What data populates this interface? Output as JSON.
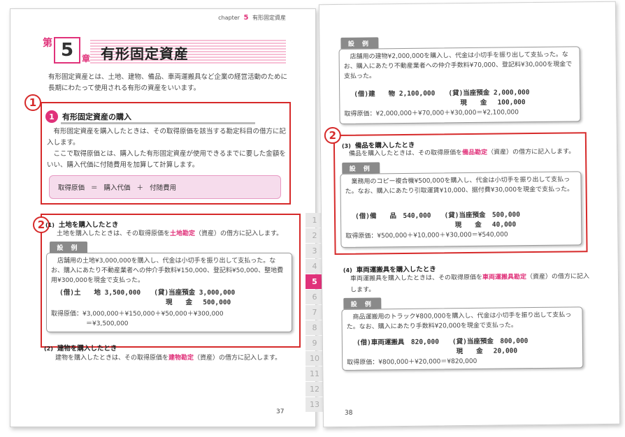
{
  "left": {
    "chapter_header_prefix": "chapter",
    "chapter_header_num": "5",
    "chapter_header_title": "有形固定資産",
    "title_dai": "第",
    "title_num": "5",
    "title_sho": "章",
    "title": "有形固定資産",
    "intro": "有形固定資産とは、土地、建物、備品、車両運搬具など企業の経営活動のために長期にわたって使用される有形の資産をいいます。",
    "badge_1": "1",
    "section1_num": "1",
    "section1_title": "有形固定資産の購入",
    "section1_p1": "有形固定資産を購入したときは、その取得原価を該当する勘定科目の借方に記入します。",
    "section1_p2": "ここで取得原価とは、購入した有形固定資産が使用できるまでに要した金額をいい、購入代価に付随費用を加算して計算します。",
    "formula": "取得原価 ＝ 購入代価 ＋ 付随費用",
    "badge_2": "2",
    "sub1_num": "(1)",
    "sub1_title": "土地を購入したとき",
    "sub1_pre": "土地を購入したときは、その取得原価を",
    "sub1_account": "土地勘定",
    "sub1_post": "（資産）の借方に記入します。",
    "example_label": "設 例",
    "ex1_text": "店舗用の土地¥3,000,000を購入し、代金は小切手を振り出して支払った。なお、購入にあたり不動産業者への仲介手数料¥150,000、登記料¥50,000、整地費用¥300,000を現金で支払った。",
    "ex1_entry1": "(借)土　　地 3,500,000　　(貸)当座預金 3,000,000",
    "ex1_entry2": "　　　　　　　　　　　　　　　　現　　金　 500,000",
    "ex1_calc1": "取得原価：¥3,000,000＋¥150,000＋¥50,000＋¥300,000",
    "ex1_calc2": "＝¥3,500,000",
    "sub2_num": "(2)",
    "sub2_title": "建物を購入したとき",
    "sub2_pre": "建物を購入したときは、その取得原価を",
    "sub2_account": "建物勘定",
    "sub2_post": "（資産）の借方に記入します。",
    "page_number": "37",
    "tabs": [
      "1",
      "2",
      "3",
      "4",
      "5",
      "6",
      "7",
      "8",
      "9",
      "10",
      "11",
      "12",
      "13"
    ]
  },
  "right": {
    "example_label": "設 例",
    "ex2_text": "店舗用の建物¥2,000,000を購入し、代金は小切手を振り出して支払った。なお、購入にあたり不動産業者への仲介手数料¥70,000、登記料¥30,000を現金で支払った。",
    "ex2_entry1": "(借)建　　物 2,100,000　　(貸)当座預金 2,000,000",
    "ex2_entry2": "　　　　　　　　　　　　　　　　現　　金　 100,000",
    "ex2_calc": "取得原価：¥2,000,000＋¥70,000＋¥30,000＝¥2,100,000",
    "badge_2": "2",
    "sub3_num": "(3)",
    "sub3_title": "備品を購入したとき",
    "sub3_pre": "備品を購入したときは、その取得原価を",
    "sub3_account": "備品勘定",
    "sub3_post": "（資産）の借方に記入します。",
    "ex3_text": "業務用のコピー複合機¥500,000を購入し、代金は小切手を振り出して支払った。なお、購入にあたり引取運賃¥10,000、据付費¥30,000を現金で支払った。",
    "ex3_entry1": "(借)備　　品　540,000　　(貸)当座預金　500,000",
    "ex3_entry2": "　　　　　　　　　　　　　　　現　　金　 40,000",
    "ex3_calc": "取得原価：¥500,000＋¥10,000＋¥30,000＝¥540,000",
    "sub4_num": "(4)",
    "sub4_title": "車両運搬具を購入したとき",
    "sub4_pre": "車両運搬具を購入したときは、その取得原価を",
    "sub4_account": "車両運搬具勘定",
    "sub4_post": "（資産）の借方に記入します。",
    "ex4_text": "商品運搬用のトラック¥800,000を購入し、代金は小切手を振り出して支払った。なお、購入にあたり手数料¥20,000を現金で支払った。",
    "ex4_entry1": "(借)車両運搬具　820,000　　(貸)当座預金　800,000",
    "ex4_entry2": "　　　　　　　　　　　　　　　現　　金　 20,000",
    "ex4_calc": "取得原価：¥800,000＋¥20,000＝¥820,000",
    "page_number": "38"
  }
}
